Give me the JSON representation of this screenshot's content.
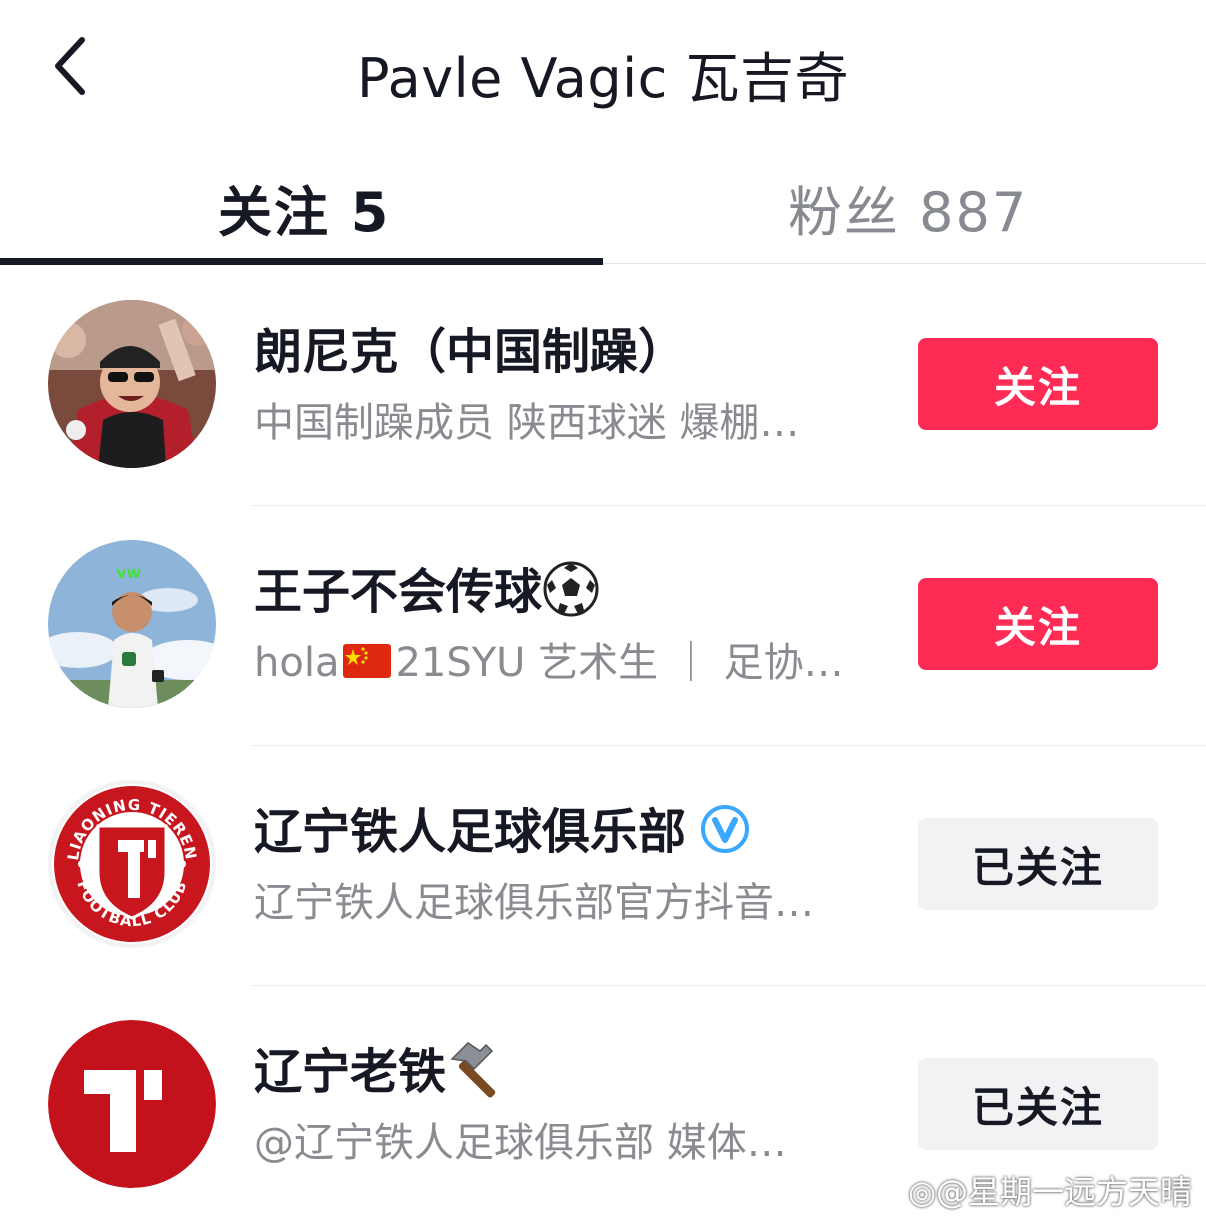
{
  "header": {
    "title": "Pavle Vagic 瓦吉奇",
    "back_icon": "chevron-left-icon"
  },
  "tabs": {
    "following": "关注 5",
    "fans": "粉丝 887"
  },
  "list": [
    {
      "name": "朗尼克（中国制躁）",
      "desc": "中国制躁成员 陕西球迷 爆棚…",
      "button": "关注",
      "button_state": "follow",
      "avatar": "fan-photo-avatar"
    },
    {
      "name": "王子不会传球",
      "name_emoji": "soccer-ball-icon",
      "desc_prefix": "hola",
      "desc_flag": "china-flag-icon",
      "desc": "21SYU 艺术生 ｜ 足协…",
      "button": "关注",
      "button_state": "follow",
      "avatar": "player-photo-avatar"
    },
    {
      "name": "辽宁铁人足球俱乐部",
      "name_badge": "verified-icon",
      "desc": "辽宁铁人足球俱乐部官方抖音…",
      "button": "已关注",
      "button_state": "followed",
      "avatar": "liaoning-tieren-logo",
      "logo_text_top": "LIAONING TIEREN",
      "logo_text_bottom": "FOOTBALL CLUB"
    },
    {
      "name": "辽宁老铁",
      "name_emoji": "hammer-icon",
      "desc": "@辽宁铁人足球俱乐部  媒体…",
      "button": "已关注",
      "button_state": "followed",
      "avatar": "tieren-red-logo"
    }
  ],
  "watermark": "@星期一远方天晴",
  "colors": {
    "follow_button": "#fe2c55",
    "followed_button": "#f2f2f4",
    "primary_text": "#161823",
    "secondary_text": "#8a8b91"
  }
}
